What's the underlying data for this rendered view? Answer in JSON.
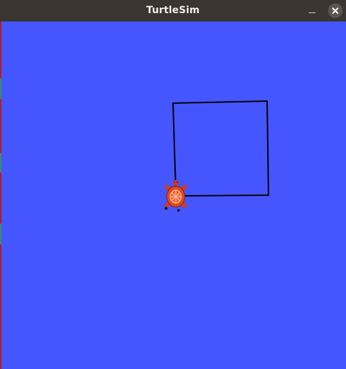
{
  "window": {
    "title": "TurtleSim",
    "background_color": "#4556ff",
    "titlebar_color": "#3a3531",
    "controls": {
      "minimize_icon": "minimize-icon",
      "close_icon": "close-icon"
    }
  },
  "simulation": {
    "pen_color": "#000000",
    "turtle_icon": "turtle-icon",
    "turtle_color": "#e5471b"
  }
}
